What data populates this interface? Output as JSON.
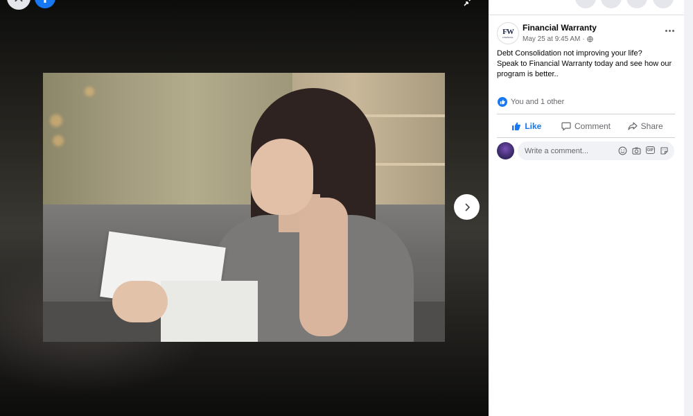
{
  "viewer": {
    "close_icon": "close-icon",
    "brand_icon": "facebook-logo-icon",
    "brand_letter": "f",
    "expand_icon": "minimize-icon",
    "next_icon": "chevron-right-icon",
    "photo_description": "Woman holding a letter and covering her face on a sofa"
  },
  "post": {
    "page_name": "Financial Warranty",
    "avatar_text": "FW",
    "avatar_subtext": "FINANCIAL",
    "timestamp": "May 25 at 9:45 AM",
    "dot_separator": "·",
    "privacy_icon": "globe-icon",
    "more_icon": "more-options-icon",
    "text_line1": "Debt Consolidation not improving your life?",
    "text_line2": "Speak to Financial Warranty today and see how our program is better.."
  },
  "reactions": {
    "summary": "You and 1 other",
    "icon": "like-badge-icon"
  },
  "actions": {
    "like": "Like",
    "comment": "Comment",
    "share": "Share"
  },
  "comment": {
    "placeholder": "Write a comment..."
  },
  "colors": {
    "accent": "#1877f2",
    "muted_text": "#65676b",
    "input_bg": "#f0f2f5"
  }
}
